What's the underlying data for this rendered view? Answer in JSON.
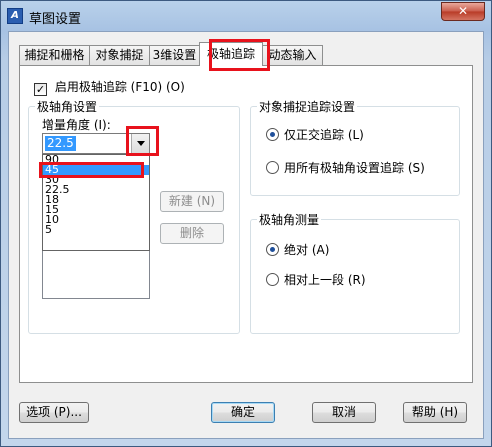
{
  "window": {
    "title": "草图设置",
    "app_icon": "A",
    "close_label": "✕"
  },
  "tabs": [
    {
      "label": "捕捉和栅格"
    },
    {
      "label": "对象捕捉"
    },
    {
      "label": "3维设置"
    },
    {
      "label": "极轴追踪"
    },
    {
      "label": "动态输入"
    }
  ],
  "polar": {
    "enable_checked": true,
    "enable_label": "启用极轴追踪 (F10) (O)",
    "angle_group_title": "极轴角设置",
    "increment_label": "增量角度 (I):",
    "increment_value": "22.5",
    "dropdown_options": [
      "90",
      "45",
      "30",
      "22.5",
      "18",
      "15",
      "10",
      "5"
    ],
    "dropdown_selected": "45",
    "new_button": "新建 (N)",
    "delete_button": "删除"
  },
  "osnap_tracking": {
    "title": "对象捕捉追踪设置",
    "options": [
      {
        "label": "仅正交追踪 (L)",
        "selected": true
      },
      {
        "label": "用所有极轴角设置追踪 (S)",
        "selected": false
      }
    ]
  },
  "polar_measure": {
    "title": "极轴角测量",
    "options": [
      {
        "label": "绝对 (A)",
        "selected": true
      },
      {
        "label": "相对上一段 (R)",
        "selected": false
      }
    ]
  },
  "footer": {
    "options_button": "选项 (P)...",
    "ok_button": "确定",
    "cancel_button": "取消",
    "help_button": "帮助 (H)"
  },
  "colors": {
    "highlight_red": "#e8121c",
    "selection_blue": "#3399ff"
  }
}
